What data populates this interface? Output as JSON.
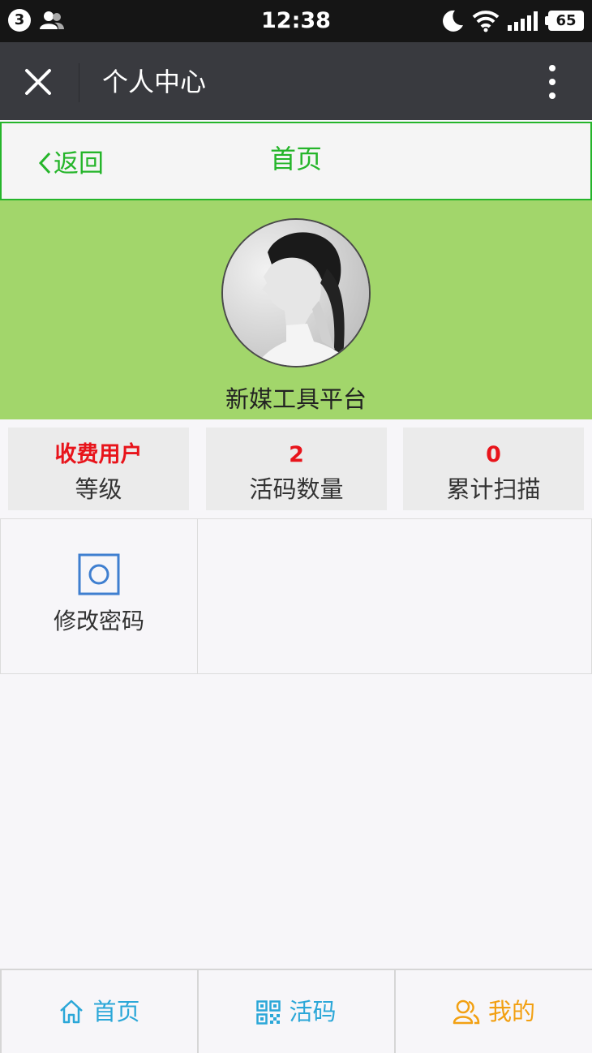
{
  "status_bar": {
    "notification_count": "3",
    "time": "12:38",
    "battery": "65",
    "icons": [
      "user-group-icon",
      "moon-icon",
      "wifi-icon",
      "signal-icon",
      "battery-icon"
    ]
  },
  "title_bar": {
    "title": "个人中心",
    "icons": [
      "close-icon",
      "more-vertical-icon"
    ]
  },
  "nav": {
    "back_label": "返回",
    "title": "首页",
    "accent_color": "#25b52a"
  },
  "profile": {
    "name": "新媒工具平台",
    "background_color": "#a2d66b"
  },
  "stats": [
    {
      "value": "收费用户",
      "label": "等级"
    },
    {
      "value": "2",
      "label": "活码数量"
    },
    {
      "value": "0",
      "label": "累计扫描"
    }
  ],
  "stat_value_color": "#e8141b",
  "grid": {
    "items": [
      {
        "label": "修改密码",
        "icon": "settings-square-icon"
      }
    ]
  },
  "tabs": [
    {
      "label": "首页",
      "icon": "home-icon",
      "color": "#2ba7d8"
    },
    {
      "label": "活码",
      "icon": "qr-code-icon",
      "color": "#2ba7d8"
    },
    {
      "label": "我的",
      "icon": "users-icon",
      "color": "#f2a012"
    }
  ]
}
